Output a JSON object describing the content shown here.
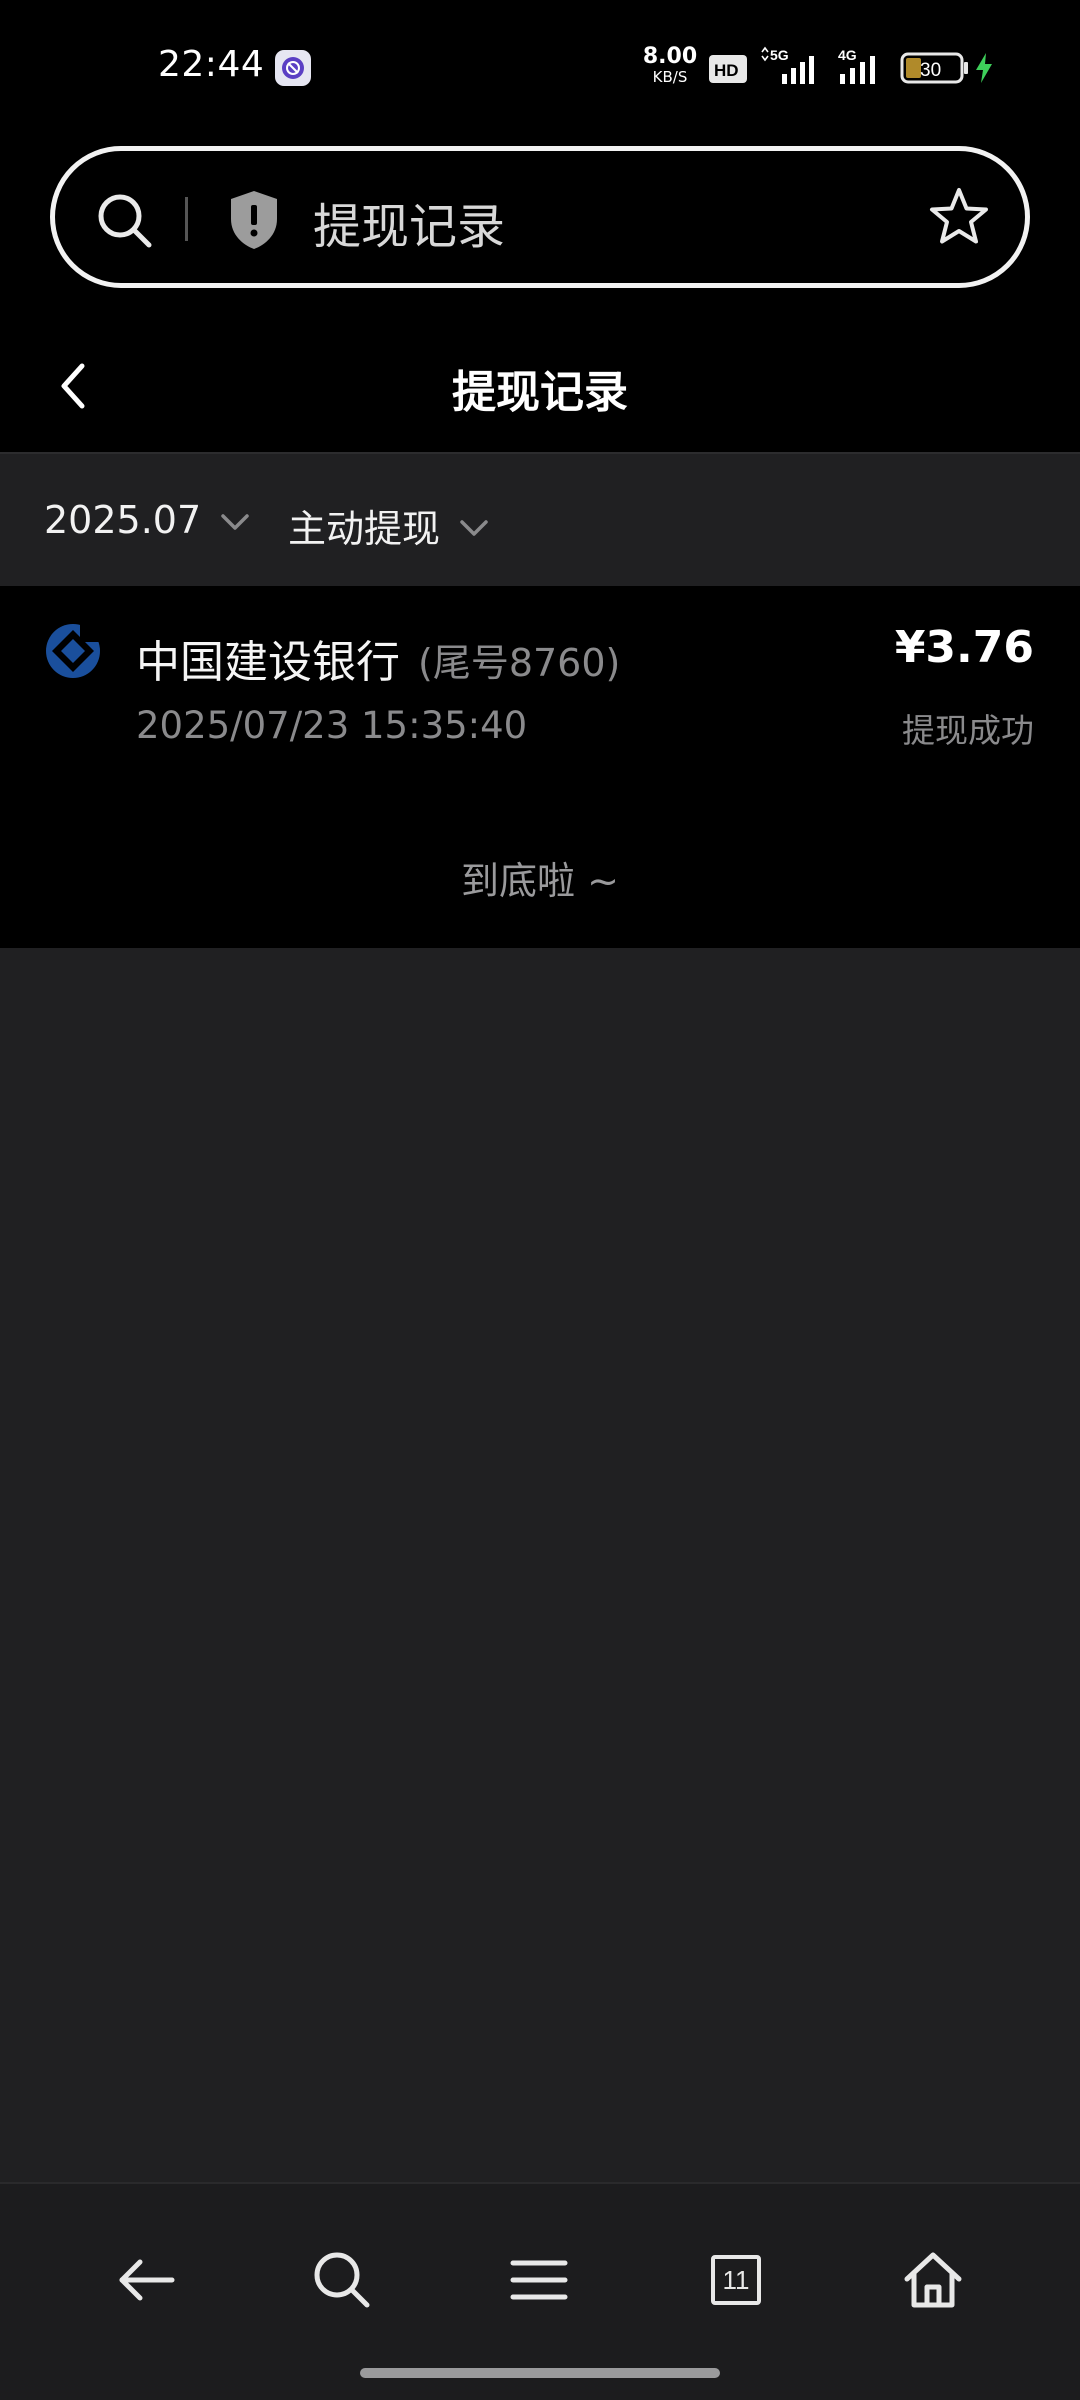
{
  "status_bar": {
    "time": "22:44",
    "net_speed_value": "8.00",
    "net_speed_unit": "KB/S",
    "hd_badge": "HD",
    "signal_5g": "5G",
    "signal_4g": "4G",
    "battery": "30",
    "charging_color": "#3ecf5a"
  },
  "search": {
    "query": "提现记录"
  },
  "header": {
    "title": "提现记录"
  },
  "filters": {
    "month": "2025.07",
    "type": "主动提现"
  },
  "records": [
    {
      "bank": "中国建设银行",
      "suffix": "(尾号8760)",
      "time": "2025/07/23 15:35:40",
      "amount": "¥3.76",
      "status": "提现成功",
      "logo_color": "#1a4f9c"
    }
  ],
  "list_end": "到底啦 ~",
  "toolbar": {
    "tab_count": "11"
  }
}
